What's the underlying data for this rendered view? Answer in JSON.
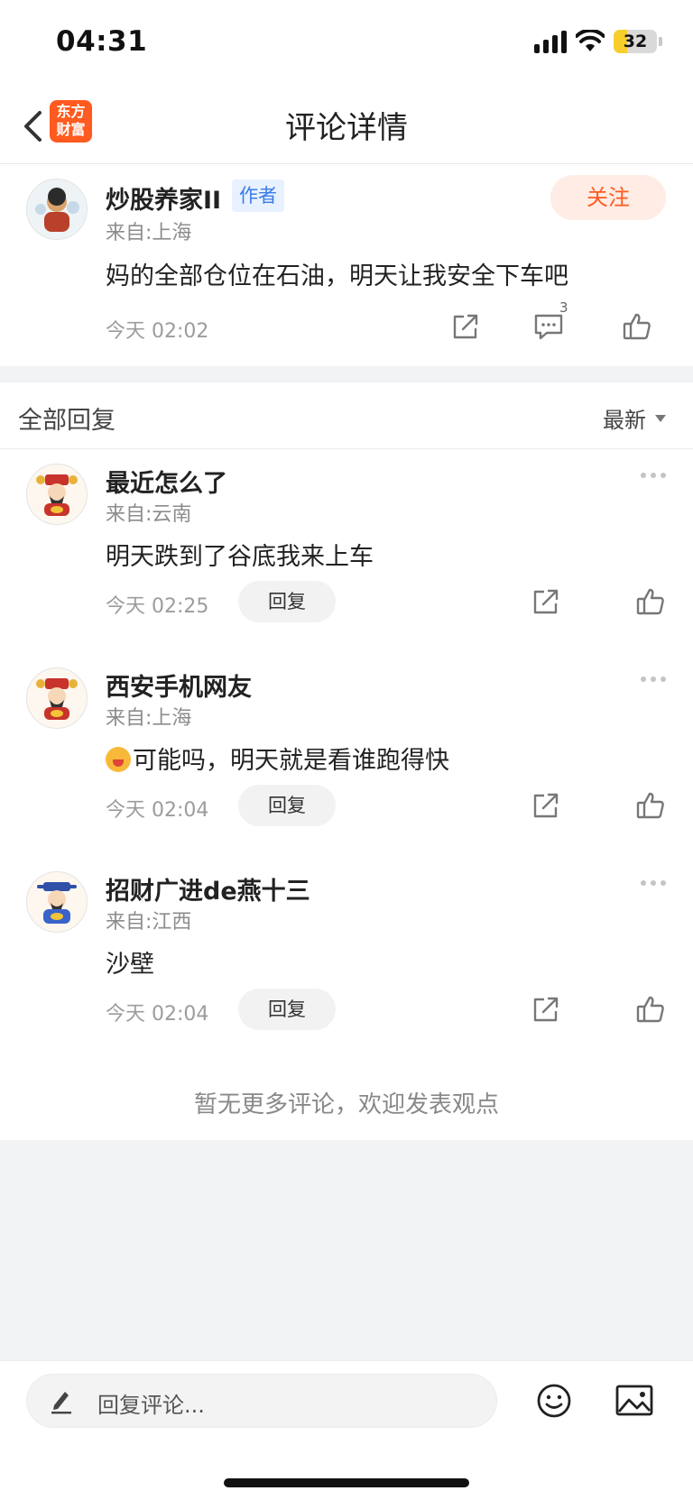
{
  "status_bar": {
    "time": "04:31",
    "battery": "32"
  },
  "nav": {
    "title": "评论详情",
    "logo_line1": "东方",
    "logo_line2": "财富"
  },
  "main_comment": {
    "username": "炒股养家II",
    "badge": "作者",
    "follow_label": "关注",
    "location": "来自:上海",
    "content": "妈的全部仓位在石油，明天让我安全下车吧",
    "time": "今天 02:02",
    "comment_count": "3"
  },
  "replies_section": {
    "title": "全部回复",
    "sort_label": "最新",
    "reply_label": "回复",
    "items": [
      {
        "username": "最近怎么了",
        "location": "来自:云南",
        "content": "明天跌到了谷底我来上车",
        "time": "今天 02:25"
      },
      {
        "username": "西安手机网友",
        "location": "来自:上海",
        "content": "可能吗，明天就是看谁跑得快",
        "time": "今天 02:04"
      },
      {
        "username": "招财广进de燕十三",
        "location": "来自:江西",
        "content": "沙壁",
        "time": "今天 02:04"
      }
    ],
    "no_more": "暂无更多评论，欢迎发表观点"
  },
  "bottom_bar": {
    "input_placeholder": "回复评论..."
  },
  "colors": {
    "accent": "#ff5a1f",
    "badge_blue": "#3a7be8"
  }
}
